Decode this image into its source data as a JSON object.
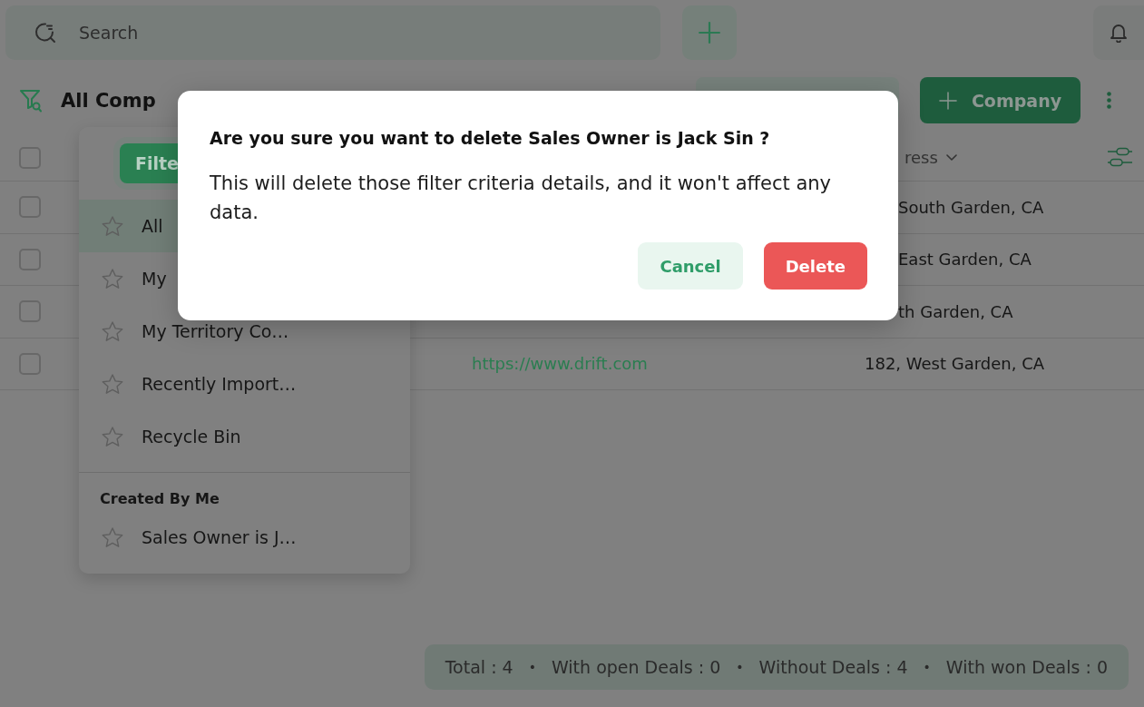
{
  "top_bar": {
    "search": {
      "placeholder": "Search"
    }
  },
  "toolbar": {
    "view_title": "All Comp",
    "add_button": "Company"
  },
  "table": {
    "select_all_checked": false,
    "column_headers": [
      "ress"
    ],
    "rows": [
      {
        "checked": false,
        "address": "South Garden, CA"
      },
      {
        "checked": false,
        "address": "East Garden, CA"
      },
      {
        "checked": false,
        "address": "th Garden, CA"
      },
      {
        "checked": false,
        "website": "https://www.drift.com",
        "address": "182, West Garden, CA"
      }
    ]
  },
  "view_menu": {
    "filter_button": "Filte",
    "items": [
      {
        "label": "All",
        "selected": true,
        "starred": false
      },
      {
        "label": "My",
        "selected": false,
        "starred": false
      },
      {
        "label": "My Territory Co…",
        "selected": false,
        "starred": false
      },
      {
        "label": "Recently Import…",
        "selected": false,
        "starred": false
      },
      {
        "label": "Recycle Bin",
        "selected": false,
        "starred": false
      }
    ],
    "sections": [
      {
        "title": "Created By Me",
        "items": [
          {
            "label": "Sales Owner is J…",
            "selected": false,
            "starred": false
          }
        ]
      }
    ]
  },
  "dialog": {
    "title": "Are you sure you want to delete Sales Owner is Jack Sin ?",
    "message": "This will delete those filter criteria details, and it won't affect any data.",
    "buttons": [
      {
        "label": "Cancel",
        "kind": "secondary"
      },
      {
        "label": "Delete",
        "kind": "danger"
      }
    ]
  },
  "summary": {
    "separator": "•",
    "items": [
      "Total : 4",
      "With open Deals : 0",
      "Without Deals : 4",
      "With won Deals : 0"
    ]
  }
}
